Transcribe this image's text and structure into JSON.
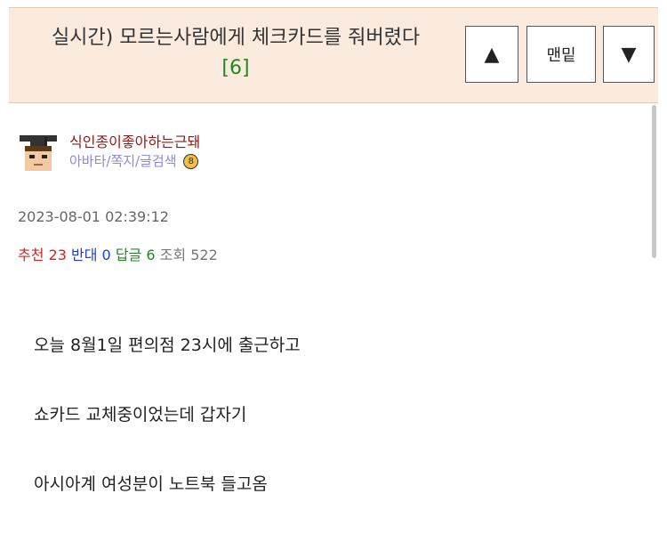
{
  "header": {
    "title": "실시간) 모르는사람에게 체크카드를 줘버렸다",
    "comment_count": "[6]",
    "up_label": "▲",
    "bottom_label": "맨밑",
    "down_label": "▼"
  },
  "author": {
    "name": "식인종이좋아하는근돼",
    "links": "아바타/쪽지/글검색",
    "badge": "8"
  },
  "post": {
    "date": "2023-08-01 02:39:12",
    "stats": {
      "recommend_label": "추천",
      "recommend_value": "23",
      "oppose_label": "반대",
      "oppose_value": "0",
      "reply_label": "답글",
      "reply_value": "6",
      "views_label": "조회",
      "views_value": "522"
    },
    "body": [
      "오늘 8월1일 편의점 23시에 출근하고",
      "쇼카드 교체중이었는데 갑자기",
      "아시아계 여성분이 노트북 들고옴"
    ]
  }
}
